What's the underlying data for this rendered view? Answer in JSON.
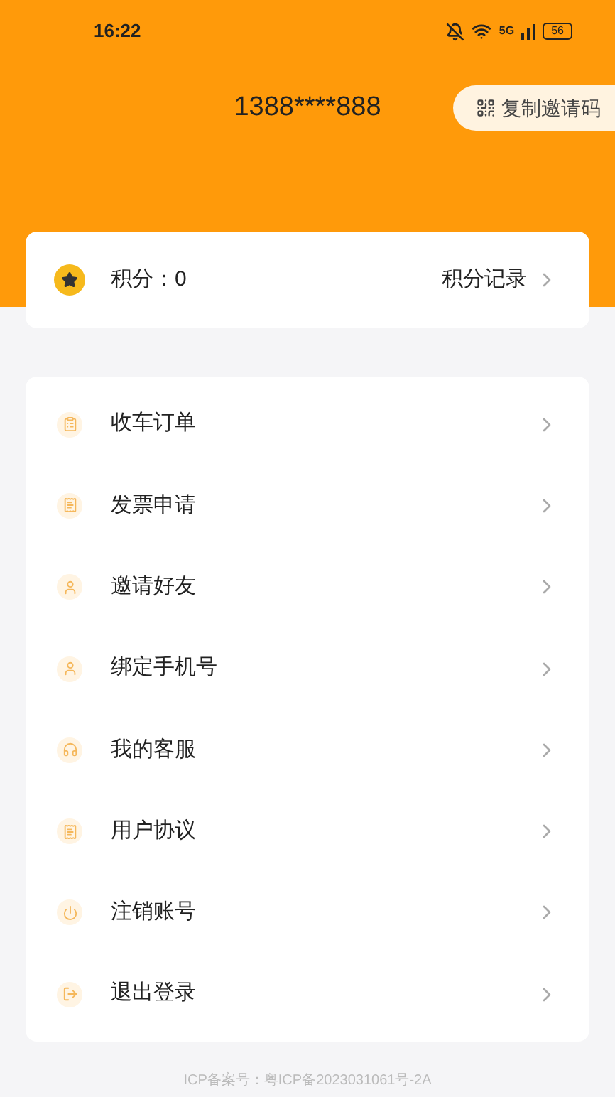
{
  "status_bar": {
    "time": "16:22",
    "network": "5G",
    "battery": "56"
  },
  "header": {
    "phone": "1388****888",
    "invite_button": "复制邀请码"
  },
  "points": {
    "label": "积分：0",
    "link": "积分记录"
  },
  "menu": [
    {
      "kind": "order",
      "label": "收车订单"
    },
    {
      "kind": "invoice",
      "label": "发票申请"
    },
    {
      "kind": "user",
      "label": "邀请好友"
    },
    {
      "kind": "user",
      "label": "绑定手机号"
    },
    {
      "kind": "service",
      "label": "我的客服"
    },
    {
      "kind": "invoice",
      "label": "用户协议"
    },
    {
      "kind": "power",
      "label": "注销账号"
    },
    {
      "kind": "logout",
      "label": "退出登录"
    }
  ],
  "footer": "ICP备案号：粤ICP备2023031061号-2A"
}
